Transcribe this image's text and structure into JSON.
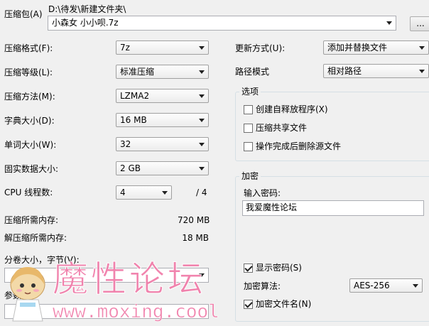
{
  "archive": {
    "label": "压缩包(A)",
    "folder": "D:\\待发\\新建文件夹\\",
    "filename": "小森女 小小呗.7z",
    "browse_label": "..."
  },
  "left": {
    "format": {
      "label": "压缩格式(F):",
      "value": "7z"
    },
    "level": {
      "label": "压缩等级(L):",
      "value": "标准压缩"
    },
    "method": {
      "label": "压缩方法(M):",
      "value": "LZMA2"
    },
    "dict": {
      "label": "字典大小(D):",
      "value": "16 MB"
    },
    "word": {
      "label": "单词大小(W):",
      "value": "32"
    },
    "solid": {
      "label": "固实数据大小:",
      "value": "2 GB"
    },
    "cpu": {
      "label": "CPU 线程数:",
      "value": "4",
      "total": "/ 4"
    },
    "mem_compress": {
      "label": "压缩所需内存:",
      "value": "720 MB"
    },
    "mem_decompress": {
      "label": "解压缩所需内存:",
      "value": "18 MB"
    },
    "split": {
      "label": "分卷大小，字节(V):",
      "value": ""
    },
    "params": {
      "label": "参数(P):",
      "value": ""
    }
  },
  "right": {
    "update": {
      "label": "更新方式(U):",
      "value": "添加并替换文件"
    },
    "path": {
      "label": "路径模式",
      "value": "相对路径"
    },
    "options": {
      "title": "选项",
      "sfx": "创建自释放程序(X)",
      "shared": "压缩共享文件",
      "delete": "操作完成后删除源文件"
    },
    "encryption": {
      "title": "加密",
      "password_label": "输入密码:",
      "password": "我爱魔性论坛",
      "show_password": "显示密码(S)",
      "method_label": "加密算法:",
      "method": "AES-256",
      "encrypt_names": "加密文件名(N)"
    }
  },
  "watermark": {
    "brand": "魔性论坛",
    "url": "www.moxing.cool",
    "color": "#f07aa8"
  }
}
